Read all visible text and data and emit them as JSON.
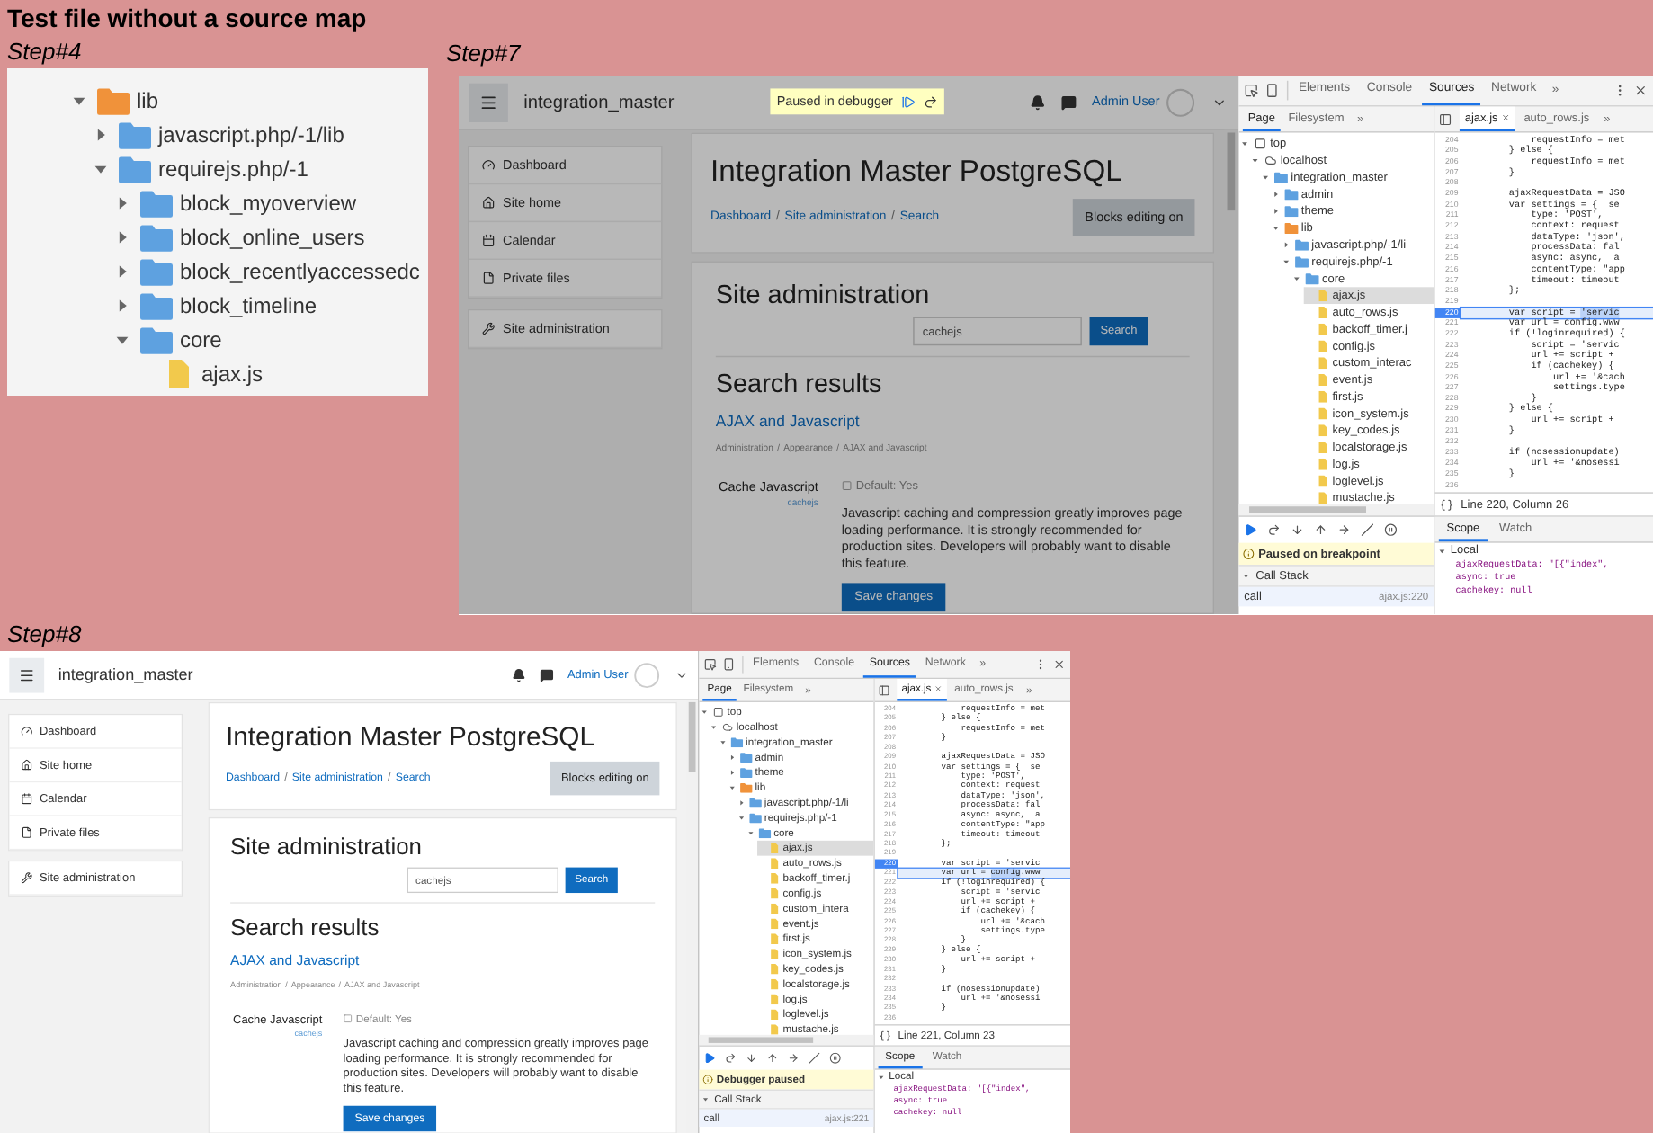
{
  "title": "Test file without a source map",
  "step4": {
    "label": "Step#4",
    "tree": [
      {
        "label": "lib",
        "kind": "folder",
        "color": "#f0923a",
        "expanded": true,
        "children": [
          {
            "label": "javascript.php/-1/lib",
            "kind": "folder",
            "color": "#5ea1e0",
            "expanded": false
          },
          {
            "label": "requirejs.php/-1",
            "kind": "folder",
            "color": "#5ea1e0",
            "expanded": true,
            "children": [
              {
                "label": "block_myoverview",
                "kind": "folder",
                "color": "#5ea1e0",
                "expanded": false
              },
              {
                "label": "block_online_users",
                "kind": "folder",
                "color": "#5ea1e0",
                "expanded": false
              },
              {
                "label": "block_recentlyaccessedc",
                "kind": "folder",
                "color": "#5ea1e0",
                "expanded": false
              },
              {
                "label": "block_timeline",
                "kind": "folder",
                "color": "#5ea1e0",
                "expanded": false
              },
              {
                "label": "core",
                "kind": "folder",
                "color": "#5ea1e0",
                "expanded": true,
                "children": [
                  {
                    "label": "ajax.js",
                    "kind": "file"
                  }
                ]
              }
            ]
          }
        ]
      }
    ]
  },
  "step7": {
    "label": "Step#7",
    "page": {
      "overlay": {
        "label": "Paused in debugger"
      },
      "navbar": {
        "site_name": "integration_master",
        "user_name": "Admin User"
      },
      "sidebar": [
        {
          "items": [
            {
              "label": "Dashboard",
              "kind": "dashboard"
            },
            {
              "label": "Site home",
              "kind": "home"
            },
            {
              "label": "Calendar",
              "kind": "calendar"
            },
            {
              "label": "Private files",
              "kind": "file"
            }
          ]
        },
        {
          "items": [
            {
              "label": "Site administration",
              "kind": "wrench"
            }
          ]
        }
      ],
      "header": {
        "title": "Integration Master PostgreSQL",
        "breadcrumb": [
          "Dashboard",
          "Site administration",
          "Search"
        ],
        "separator": "/",
        "button": "Blocks editing on"
      },
      "main": {
        "heading": "Site administration",
        "search": {
          "value": "cachejs",
          "button": "Search"
        },
        "results_heading": "Search results",
        "result_link": "AJAX and Javascript",
        "path": [
          "Administration",
          "Appearance",
          "AJAX and Javascript"
        ],
        "setting": {
          "label": "Cache Javascript",
          "name": "cachejs",
          "default": "Default: Yes",
          "description": "Javascript caching and compression greatly improves page loading performance. It is strongly recommended for production sites. Developers will probably want to disable this feature."
        },
        "save_button": "Save changes"
      }
    },
    "devtools": {
      "panels": [
        {
          "label": "Elements",
          "selected": false
        },
        {
          "label": "Console",
          "selected": false
        },
        {
          "label": "Sources",
          "selected": true
        },
        {
          "label": "Network",
          "selected": false
        }
      ],
      "more": "»",
      "navigator_tabs": [
        {
          "label": "Page",
          "selected": true
        },
        {
          "label": "Filesystem",
          "selected": false
        }
      ],
      "navigator_more": "»",
      "tree": [
        {
          "label": "top",
          "kind": "frame",
          "expanded": true,
          "selected": false,
          "children": [
            {
              "label": "localhost",
              "kind": "cloud",
              "expanded": true,
              "selected": false,
              "children": [
                {
                  "label": "integration_master",
                  "kind": "folder",
                  "color": "#5ea1e0",
                  "expanded": true,
                  "selected": false,
                  "children": [
                    {
                      "label": "admin",
                      "kind": "folder",
                      "color": "#5ea1e0",
                      "expanded": false,
                      "selected": false
                    },
                    {
                      "label": "theme",
                      "kind": "folder",
                      "color": "#5ea1e0",
                      "expanded": false,
                      "selected": false
                    },
                    {
                      "label": "lib",
                      "kind": "folder",
                      "color": "#f0923a",
                      "expanded": true,
                      "selected": false,
                      "children": [
                        {
                          "label": "javascript.php/-1/li",
                          "kind": "folder",
                          "color": "#5ea1e0",
                          "expanded": false,
                          "selected": false
                        },
                        {
                          "label": "requirejs.php/-1",
                          "kind": "folder",
                          "color": "#5ea1e0",
                          "expanded": true,
                          "selected": false,
                          "children": [
                            {
                              "label": "core",
                              "kind": "folder",
                              "color": "#5ea1e0",
                              "expanded": true,
                              "selected": false,
                              "children": [
                                {
                                  "label": "ajax.js",
                                  "kind": "file",
                                  "selected": true
                                },
                                {
                                  "label": "auto_rows.js",
                                  "kind": "file",
                                  "selected": false
                                },
                                {
                                  "label": "backoff_timer.j",
                                  "kind": "file",
                                  "selected": false
                                },
                                {
                                  "label": "config.js",
                                  "kind": "file",
                                  "selected": false
                                },
                                {
                                  "label": "custom_interac",
                                  "kind": "file",
                                  "selected": false
                                },
                                {
                                  "label": "event.js",
                                  "kind": "file",
                                  "selected": false
                                },
                                {
                                  "label": "first.js",
                                  "kind": "file",
                                  "selected": false
                                },
                                {
                                  "label": "icon_system.js",
                                  "kind": "file",
                                  "selected": false
                                },
                                {
                                  "label": "key_codes.js",
                                  "kind": "file",
                                  "selected": false
                                },
                                {
                                  "label": "localstorage.js",
                                  "kind": "file",
                                  "selected": false
                                },
                                {
                                  "label": "log.js",
                                  "kind": "file",
                                  "selected": false
                                },
                                {
                                  "label": "loglevel.js",
                                  "kind": "file",
                                  "selected": false
                                },
                                {
                                  "label": "mustache.js",
                                  "kind": "file",
                                  "selected": false
                                }
                              ]
                            }
                          ]
                        }
                      ]
                    }
                  ]
                }
              ]
            }
          ]
        }
      ],
      "editor_tabs": [
        {
          "label": "ajax.js",
          "selected": true,
          "closable": true
        },
        {
          "label": "auto_rows.js",
          "selected": false,
          "closable": false
        }
      ],
      "editor_more": "»",
      "code": [
        {
          "n": "204",
          "code": "            requestInfo = met",
          "breakpoint": false,
          "current": false
        },
        {
          "n": "205",
          "code": "        } else {",
          "breakpoint": false,
          "current": false
        },
        {
          "n": "206",
          "code": "            requestInfo = met",
          "breakpoint": false,
          "current": false
        },
        {
          "n": "207",
          "code": "        }",
          "breakpoint": false,
          "current": false
        },
        {
          "n": "208",
          "breakpoint": false,
          "current": false
        },
        {
          "n": "209",
          "code": "        ajaxRequestData = JSO",
          "breakpoint": false,
          "current": false
        },
        {
          "n": "210",
          "code": "        var settings = {  se",
          "breakpoint": false,
          "current": false
        },
        {
          "n": "211",
          "code": "            type: 'POST',",
          "breakpoint": false,
          "current": false
        },
        {
          "n": "212",
          "code": "            context: request",
          "breakpoint": false,
          "current": false
        },
        {
          "n": "213",
          "code": "            dataType: 'json',",
          "breakpoint": false,
          "current": false
        },
        {
          "n": "214",
          "code": "            processData: fal",
          "breakpoint": false,
          "current": false
        },
        {
          "n": "215",
          "code": "            async: async,  a",
          "breakpoint": false,
          "current": false
        },
        {
          "n": "216",
          "code": "            contentType: \"app",
          "breakpoint": false,
          "current": false
        },
        {
          "n": "217",
          "code": "            timeout: timeout",
          "breakpoint": false,
          "current": false
        },
        {
          "n": "218",
          "code": "        };",
          "breakpoint": false,
          "current": false
        },
        {
          "n": "219",
          "breakpoint": false,
          "current": false
        },
        {
          "n": "220",
          "code": "        var script = ",
          "token": "'servic",
          "breakpoint": true,
          "current": true
        },
        {
          "n": "221",
          "code": "        var url = config.www",
          "breakpoint": false,
          "current": false
        },
        {
          "n": "222",
          "code": "        if (!loginrequired) {",
          "breakpoint": false,
          "current": false
        },
        {
          "n": "223",
          "code": "            script = 'servic",
          "breakpoint": false,
          "current": false
        },
        {
          "n": "224",
          "code": "            url += script +",
          "breakpoint": false,
          "current": false
        },
        {
          "n": "225",
          "code": "            if (cachekey) {",
          "breakpoint": false,
          "current": false
        },
        {
          "n": "226",
          "code": "                url += '&cach",
          "breakpoint": false,
          "current": false
        },
        {
          "n": "227",
          "code": "                settings.type",
          "breakpoint": false,
          "current": false
        },
        {
          "n": "228",
          "code": "            }",
          "breakpoint": false,
          "current": false
        },
        {
          "n": "229",
          "code": "        } else {",
          "breakpoint": false,
          "current": false
        },
        {
          "n": "230",
          "code": "            url += script +",
          "breakpoint": false,
          "current": false
        },
        {
          "n": "231",
          "code": "        }",
          "breakpoint": false,
          "current": false
        },
        {
          "n": "232",
          "breakpoint": false,
          "current": false
        },
        {
          "n": "233",
          "code": "        if (nosessionupdate)",
          "breakpoint": false,
          "current": false
        },
        {
          "n": "234",
          "code": "            url += '&nosessi",
          "breakpoint": false,
          "current": false
        },
        {
          "n": "235",
          "code": "        }",
          "breakpoint": false,
          "current": false
        },
        {
          "n": "236",
          "breakpoint": false,
          "current": false
        }
      ],
      "status": "Line 220, Column 26",
      "pause_message": "Paused on breakpoint",
      "call_stack": {
        "title": "Call Stack",
        "expanded": true,
        "frames": [
          {
            "name": "call",
            "location": "ajax.js:220",
            "selected": true
          }
        ]
      },
      "sidebar_tabs": [
        {
          "label": "Scope",
          "selected": true
        },
        {
          "label": "Watch",
          "selected": false
        }
      ],
      "scope": {
        "title": "Local",
        "expanded": true,
        "vars": [
          "ajaxRequestData: \"[{\"index\",",
          "async: true",
          "cachekey: null"
        ]
      }
    }
  },
  "step8": {
    "label": "Step#8",
    "page": {
      "navbar": {
        "site_name": "integration_master",
        "user_name": "Admin User"
      },
      "sidebar": [
        {
          "items": [
            {
              "label": "Dashboard",
              "kind": "dashboard"
            },
            {
              "label": "Site home",
              "kind": "home"
            },
            {
              "label": "Calendar",
              "kind": "calendar"
            },
            {
              "label": "Private files",
              "kind": "file"
            }
          ]
        },
        {
          "items": [
            {
              "label": "Site administration",
              "kind": "wrench"
            }
          ]
        }
      ],
      "header": {
        "title": "Integration Master PostgreSQL",
        "breadcrumb": [
          "Dashboard",
          "Site administration",
          "Search"
        ],
        "separator": "/",
        "button": "Blocks editing on"
      },
      "main": {
        "heading": "Site administration",
        "search": {
          "value": "cachejs",
          "button": "Search"
        },
        "results_heading": "Search results",
        "result_link": "AJAX and Javascript",
        "path": [
          "Administration",
          "Appearance",
          "AJAX and Javascript"
        ],
        "setting": {
          "label": "Cache Javascript",
          "name": "cachejs",
          "default": "Default: Yes",
          "description": "Javascript caching and compression greatly improves page loading performance. It is strongly recommended for production sites. Developers will probably want to disable this feature."
        },
        "save_button": "Save changes"
      }
    },
    "devtools": {
      "panels": [
        {
          "label": "Elements",
          "selected": false
        },
        {
          "label": "Console",
          "selected": false
        },
        {
          "label": "Sources",
          "selected": true
        },
        {
          "label": "Network",
          "selected": false
        }
      ],
      "more": "»",
      "navigator_tabs": [
        {
          "label": "Page",
          "selected": true
        },
        {
          "label": "Filesystem",
          "selected": false
        }
      ],
      "navigator_more": "»",
      "tree": [
        {
          "label": "top",
          "kind": "frame",
          "expanded": true,
          "selected": false,
          "children": [
            {
              "label": "localhost",
              "kind": "cloud",
              "expanded": true,
              "selected": false,
              "children": [
                {
                  "label": "integration_master",
                  "kind": "folder",
                  "color": "#5ea1e0",
                  "expanded": true,
                  "selected": false,
                  "children": [
                    {
                      "label": "admin",
                      "kind": "folder",
                      "color": "#5ea1e0",
                      "expanded": false,
                      "selected": false
                    },
                    {
                      "label": "theme",
                      "kind": "folder",
                      "color": "#5ea1e0",
                      "expanded": false,
                      "selected": false
                    },
                    {
                      "label": "lib",
                      "kind": "folder",
                      "color": "#f0923a",
                      "expanded": true,
                      "selected": false,
                      "children": [
                        {
                          "label": "javascript.php/-1/li",
                          "kind": "folder",
                          "color": "#5ea1e0",
                          "expanded": false,
                          "selected": false
                        },
                        {
                          "label": "requirejs.php/-1",
                          "kind": "folder",
                          "color": "#5ea1e0",
                          "expanded": true,
                          "selected": false,
                          "children": [
                            {
                              "label": "core",
                              "kind": "folder",
                              "color": "#5ea1e0",
                              "expanded": true,
                              "selected": false,
                              "children": [
                                {
                                  "label": "ajax.js",
                                  "kind": "file",
                                  "selected": true
                                },
                                {
                                  "label": "auto_rows.js",
                                  "kind": "file",
                                  "selected": false
                                },
                                {
                                  "label": "backoff_timer.j",
                                  "kind": "file",
                                  "selected": false
                                },
                                {
                                  "label": "config.js",
                                  "kind": "file",
                                  "selected": false
                                },
                                {
                                  "label": "custom_intera",
                                  "kind": "file",
                                  "selected": false
                                },
                                {
                                  "label": "event.js",
                                  "kind": "file",
                                  "selected": false
                                },
                                {
                                  "label": "first.js",
                                  "kind": "file",
                                  "selected": false
                                },
                                {
                                  "label": "icon_system.js",
                                  "kind": "file",
                                  "selected": false
                                },
                                {
                                  "label": "key_codes.js",
                                  "kind": "file",
                                  "selected": false
                                },
                                {
                                  "label": "localstorage.js",
                                  "kind": "file",
                                  "selected": false
                                },
                                {
                                  "label": "log.js",
                                  "kind": "file",
                                  "selected": false
                                },
                                {
                                  "label": "loglevel.js",
                                  "kind": "file",
                                  "selected": false
                                },
                                {
                                  "label": "mustache.js",
                                  "kind": "file",
                                  "selected": false
                                }
                              ]
                            }
                          ]
                        }
                      ]
                    }
                  ]
                }
              ]
            }
          ]
        }
      ],
      "editor_tabs": [
        {
          "label": "ajax.js",
          "selected": true,
          "closable": true
        },
        {
          "label": "auto_rows.js",
          "selected": false,
          "closable": false
        }
      ],
      "editor_more": "»",
      "code": [
        {
          "n": "204",
          "code": "            requestInfo = met",
          "breakpoint": false,
          "current": false
        },
        {
          "n": "205",
          "code": "        } else {",
          "breakpoint": false,
          "current": false
        },
        {
          "n": "206",
          "code": "            requestInfo = met",
          "breakpoint": false,
          "current": false
        },
        {
          "n": "207",
          "code": "        }",
          "breakpoint": false,
          "current": false
        },
        {
          "n": "208",
          "breakpoint": false,
          "current": false
        },
        {
          "n": "209",
          "code": "        ajaxRequestData = JSO",
          "breakpoint": false,
          "current": false
        },
        {
          "n": "210",
          "code": "        var settings = {  se",
          "breakpoint": false,
          "current": false
        },
        {
          "n": "211",
          "code": "            type: 'POST',",
          "breakpoint": false,
          "current": false
        },
        {
          "n": "212",
          "code": "            context: request",
          "breakpoint": false,
          "current": false
        },
        {
          "n": "213",
          "code": "            dataType: 'json',",
          "breakpoint": false,
          "current": false
        },
        {
          "n": "214",
          "code": "            processData: fal",
          "breakpoint": false,
          "current": false
        },
        {
          "n": "215",
          "code": "            async: async,  a",
          "breakpoint": false,
          "current": false
        },
        {
          "n": "216",
          "code": "            contentType: \"app",
          "breakpoint": false,
          "current": false
        },
        {
          "n": "217",
          "code": "            timeout: timeout",
          "breakpoint": false,
          "current": false
        },
        {
          "n": "218",
          "code": "        };",
          "breakpoint": false,
          "current": false
        },
        {
          "n": "219",
          "breakpoint": false,
          "current": false
        },
        {
          "n": "220",
          "code": "        var script = 'servic",
          "breakpoint": true,
          "current": false
        },
        {
          "n": "221",
          "code": "        var url = ",
          "token": "config",
          "rest": ".www",
          "breakpoint": false,
          "current": true
        },
        {
          "n": "222",
          "code": "        if (!loginrequired) {",
          "breakpoint": false,
          "current": false
        },
        {
          "n": "223",
          "code": "            script = 'servic",
          "breakpoint": false,
          "current": false
        },
        {
          "n": "224",
          "code": "            url += script +",
          "breakpoint": false,
          "current": false
        },
        {
          "n": "225",
          "code": "            if (cachekey) {",
          "breakpoint": false,
          "current": false
        },
        {
          "n": "226",
          "code": "                url += '&cach",
          "breakpoint": false,
          "current": false
        },
        {
          "n": "227",
          "code": "                settings.type",
          "breakpoint": false,
          "current": false
        },
        {
          "n": "228",
          "code": "            }",
          "breakpoint": false,
          "current": false
        },
        {
          "n": "229",
          "code": "        } else {",
          "breakpoint": false,
          "current": false
        },
        {
          "n": "230",
          "code": "            url += script +",
          "breakpoint": false,
          "current": false
        },
        {
          "n": "231",
          "code": "        }",
          "breakpoint": false,
          "current": false
        },
        {
          "n": "232",
          "breakpoint": false,
          "current": false
        },
        {
          "n": "233",
          "code": "        if (nosessionupdate)",
          "breakpoint": false,
          "current": false
        },
        {
          "n": "234",
          "code": "            url += '&nosessi",
          "breakpoint": false,
          "current": false
        },
        {
          "n": "235",
          "code": "        }",
          "breakpoint": false,
          "current": false
        },
        {
          "n": "236",
          "breakpoint": false,
          "current": false
        }
      ],
      "status": "Line 221, Column 23",
      "pause_message": "Debugger paused",
      "call_stack": {
        "title": "Call Stack",
        "expanded": true,
        "frames": [
          {
            "name": "call",
            "location": "ajax.js:221",
            "selected": true
          }
        ]
      },
      "sidebar_tabs": [
        {
          "label": "Scope",
          "selected": true
        },
        {
          "label": "Watch",
          "selected": false
        }
      ],
      "scope": {
        "title": "Local",
        "expanded": true,
        "vars": [
          "ajaxRequestData: \"[{\"index\",",
          "async: true",
          "cachekey: null"
        ]
      }
    }
  }
}
